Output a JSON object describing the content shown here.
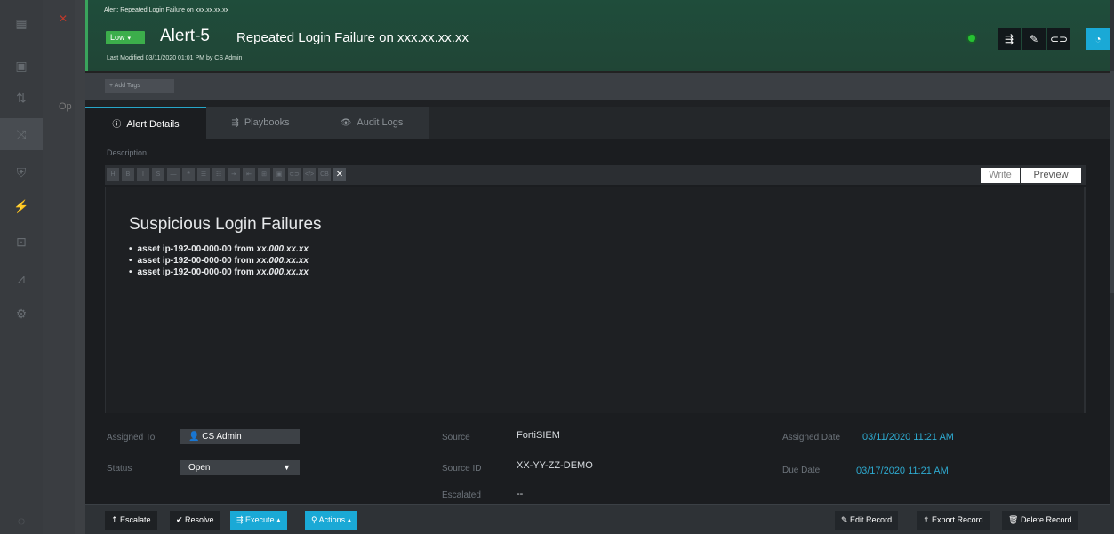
{
  "header": {
    "breadcrumb": "Alert: Repeated Login Failure on xxx.xx.xx.xx",
    "severity": "Low",
    "severity_caret": "▾",
    "alert_id": "Alert-5",
    "alert_title": "Repeated Login Failure on xxx.xx.xx.xx",
    "modified": "Last Modified 03/11/2020 01:01 PM by CS Admin"
  },
  "tags": {
    "add_tags": "+ Add Tags"
  },
  "tabs": [
    {
      "label": "Alert Details",
      "icon": "ⓘ"
    },
    {
      "label": "Playbooks",
      "icon": "⇶"
    },
    {
      "label": "Audit Logs",
      "icon": "👁"
    }
  ],
  "description": {
    "label": "Description",
    "toolbar": [
      "H",
      "B",
      "I",
      "S",
      "—",
      "❝",
      "☰",
      "☷",
      "⇥",
      "⇤",
      "⊞",
      "▣",
      "⊂⊃",
      "</>",
      "CB",
      "✕"
    ],
    "write": "Write",
    "preview": "Preview",
    "heading": "Suspicious Login Failures",
    "items": [
      {
        "asset": "asset ip-192-00-000-00",
        "from": "from",
        "ip": "xx.000.xx.xx"
      },
      {
        "asset": "asset ip-192-00-000-00",
        "from": "from",
        "ip": "xx.000.xx.xx"
      },
      {
        "asset": "asset ip-192-00-000-00",
        "from": "from",
        "ip": "xx.000.xx.xx"
      }
    ]
  },
  "fields": {
    "assigned_to_label": "Assigned To",
    "assigned_to_value": "CS Admin",
    "status_label": "Status",
    "status_value": "Open",
    "source_label": "Source",
    "source_value": "FortiSIEM",
    "source_id_label": "Source ID",
    "source_id_value": "XX-YY-ZZ-DEMO",
    "escalated_label": "Escalated",
    "escalated_value": "--",
    "assigned_date_label": "Assigned Date",
    "assigned_date_value": "03/11/2020 11:21 AM",
    "due_date_label": "Due Date",
    "due_date_value": "03/17/2020 11:21 AM"
  },
  "actions": {
    "escalate": "Escalate",
    "resolve": "Resolve",
    "execute": "Execute",
    "actions": "Actions",
    "edit_record": "Edit Record",
    "export_record": "Export Record",
    "delete_record": "Delete Record"
  },
  "background": {
    "op": "Op"
  }
}
